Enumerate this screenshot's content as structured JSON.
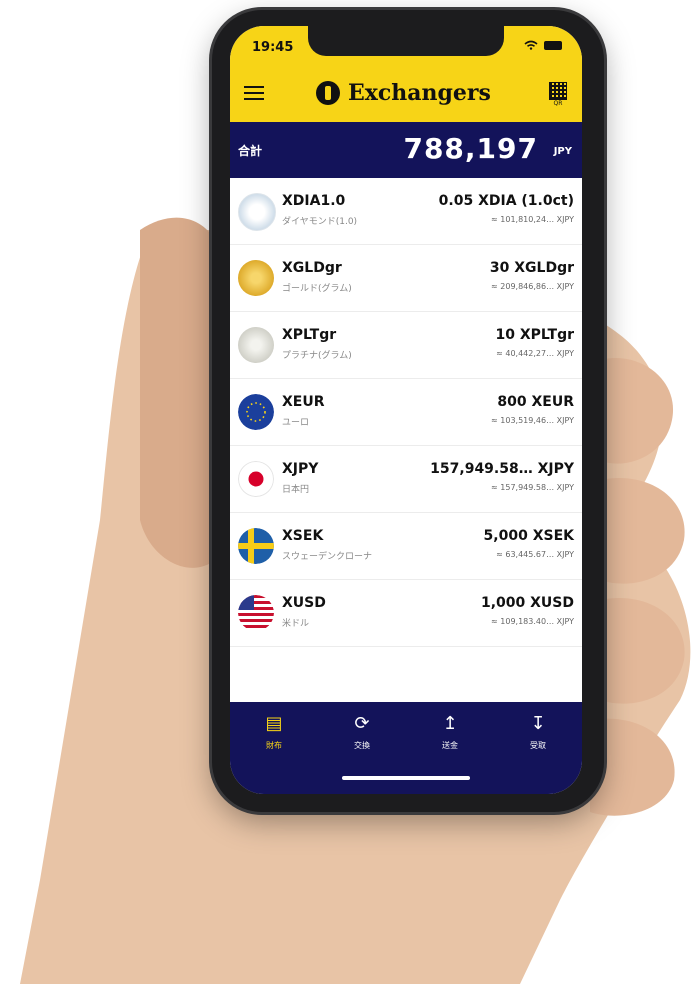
{
  "status": {
    "time": "19:45"
  },
  "header": {
    "brand": "Exchangers",
    "qr_label": "QR"
  },
  "total": {
    "label": "合計",
    "amount": "788,197",
    "unit": "JPY"
  },
  "assets": [
    {
      "symbol": "XDIA1.0",
      "name": "ダイヤモンド(1.0)",
      "amount": "0.05 XDIA (1.0ct)",
      "converted": "≈ 101,810,24… XJPY",
      "icon": "diamond-icon",
      "color": "#d9e6f2"
    },
    {
      "symbol": "XGLDgr",
      "name": "ゴールド(グラム)",
      "amount": "30 XGLDgr",
      "converted": "≈ 209,846,86… XJPY",
      "icon": "gold-coin-icon",
      "color": "#e6b838"
    },
    {
      "symbol": "XPLTgr",
      "name": "プラチナ(グラム)",
      "amount": "10 XPLTgr",
      "converted": "≈ 40,442,27… XJPY",
      "icon": "platinum-coin-icon",
      "color": "#d8d8d0"
    },
    {
      "symbol": "XEUR",
      "name": "ユーロ",
      "amount": "800 XEUR",
      "converted": "≈ 103,519,46… XJPY",
      "icon": "eu-flag-icon",
      "color": "#1b3f9c"
    },
    {
      "symbol": "XJPY",
      "name": "日本円",
      "amount": "157,949.58… XJPY",
      "converted": "≈ 157,949.58… XJPY",
      "icon": "japan-flag-icon",
      "color": "#ffffff"
    },
    {
      "symbol": "XSEK",
      "name": "スウェーデンクローナ",
      "amount": "5,000 XSEK",
      "converted": "≈ 63,445.67… XJPY",
      "icon": "sweden-flag-icon",
      "color": "#1f5fa8"
    },
    {
      "symbol": "XUSD",
      "name": "米ドル",
      "amount": "1,000 XUSD",
      "converted": "≈ 109,183.40… XJPY",
      "icon": "us-flag-icon",
      "color": "#c8102e"
    }
  ],
  "tabs": [
    {
      "label": "財布",
      "icon": "wallet-icon"
    },
    {
      "label": "交換",
      "icon": "exchange-icon"
    },
    {
      "label": "送金",
      "icon": "send-icon"
    },
    {
      "label": "受取",
      "icon": "receive-icon"
    }
  ],
  "colors": {
    "brand_yellow": "#f7d417",
    "navy": "#13135a"
  }
}
